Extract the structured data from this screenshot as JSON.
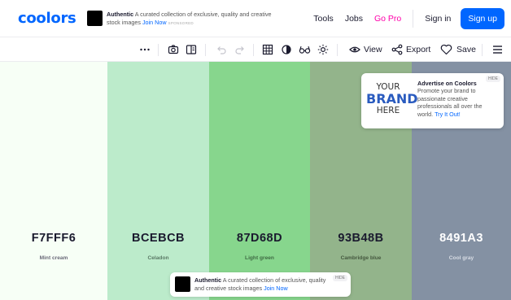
{
  "nav": {
    "logo": "coolors",
    "ad": {
      "brand": "Authentic",
      "text": "A curated collection of exclusive, quality and creative stock images",
      "cta": "Join Now",
      "sponsored": "SPONSORED"
    },
    "links": [
      "Tools",
      "Jobs",
      "Go Pro"
    ],
    "signin": "Sign in",
    "signup": "Sign up",
    "pro_color": "#ff00aa",
    "accent": "#0066ff"
  },
  "toolbar": {
    "view_label": "View",
    "export_label": "Export",
    "save_label": "Save"
  },
  "palette": [
    {
      "hex": "F7FFF6",
      "name": "Mint cream",
      "color": "#F7FFF6",
      "text_color": "#1a1a2e",
      "name_color": "#6b6b7a"
    },
    {
      "hex": "BCEBCB",
      "name": "Celadon",
      "color": "#BCEBCB",
      "text_color": "#1a1a2e",
      "name_color": "#5b7a66"
    },
    {
      "hex": "87D68D",
      "name": "Light green",
      "color": "#87D68D",
      "text_color": "#1a1a2e",
      "name_color": "#3f6b43"
    },
    {
      "hex": "93B48B",
      "name": "Cambridge blue",
      "color": "#93B48B",
      "text_color": "#1a1a2e",
      "name_color": "#45583f"
    },
    {
      "hex": "8491A3",
      "name": "Cool gray",
      "color": "#8491A3",
      "text_color": "#ffffff",
      "name_color": "#d8dde5"
    }
  ],
  "ad_card": {
    "brand_lines": [
      "YOUR",
      "BRAND",
      "HERE"
    ],
    "title": "Advertise on Coolors",
    "body": "Promote your brand to passionate creative professionals all over the world.",
    "cta": "Try It Out!",
    "hide": "HIDE"
  },
  "ad_bottom": {
    "brand": "Authentic",
    "text": "A curated collection of exclusive, quality and creative stock images",
    "cta": "Join Now",
    "hide": "HIDE"
  }
}
